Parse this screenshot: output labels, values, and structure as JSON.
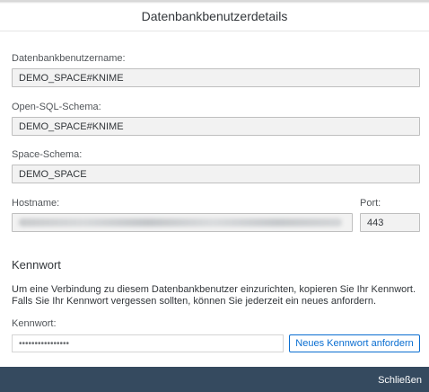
{
  "dialog": {
    "title": "Datenbankbenutzerdetails"
  },
  "fields": {
    "db_user_label": "Datenbankbenutzername:",
    "db_user_value": "DEMO_SPACE#KNIME",
    "open_sql_label": "Open-SQL-Schema:",
    "open_sql_value": "DEMO_SPACE#KNIME",
    "space_schema_label": "Space-Schema:",
    "space_schema_value": "DEMO_SPACE",
    "hostname_label": "Hostname:",
    "port_label": "Port:",
    "port_value": "443"
  },
  "password": {
    "section_title": "Kennwort",
    "hint": "Um eine Verbindung zu diesem Datenbankbenutzer einzurichten, kopieren Sie Ihr Kennwort. Falls Sie Ihr Kennwort vergessen sollten, können Sie jederzeit ein neues anfordern.",
    "label": "Kennwort:",
    "masked_value": "••••••••••••••••",
    "request_button": "Neues Kennwort anfordern"
  },
  "footer": {
    "close_label": "Schließen"
  }
}
